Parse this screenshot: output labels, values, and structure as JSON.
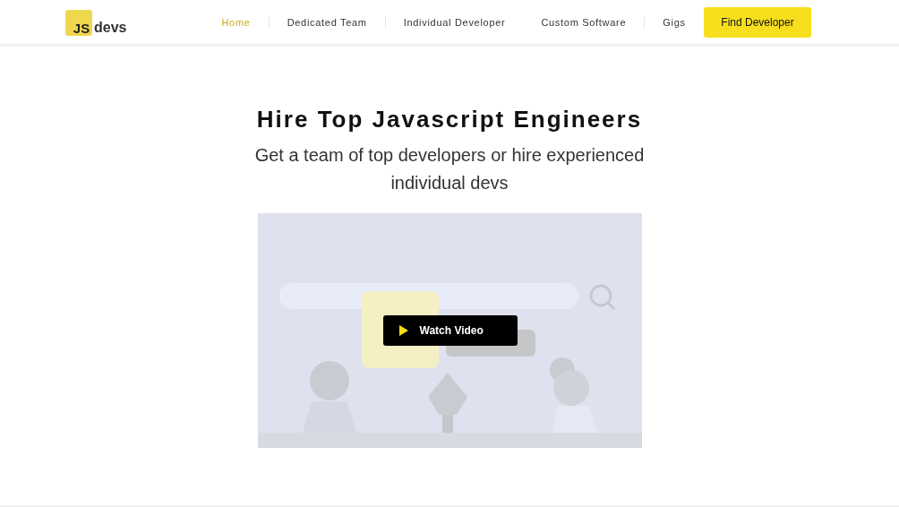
{
  "logo": {
    "mark": "JS",
    "text": "devs"
  },
  "nav": [
    {
      "label": "Home",
      "selected": true,
      "divider_before": false
    },
    {
      "label": "Dedicated Team",
      "selected": false,
      "divider_before": true
    },
    {
      "label": "Individual Developer",
      "selected": false,
      "divider_before": true
    },
    {
      "label": "Custom Software",
      "selected": false,
      "divider_before": false
    },
    {
      "label": "Gigs",
      "selected": false,
      "divider_before": true
    }
  ],
  "cta": "Find Developer",
  "hero": {
    "title": "Hire Top Javascript Engineers",
    "subtitle": "Get a team of top developers or hire experienced individual devs"
  },
  "video": {
    "kind": "picture",
    "button": "Watch Video"
  }
}
